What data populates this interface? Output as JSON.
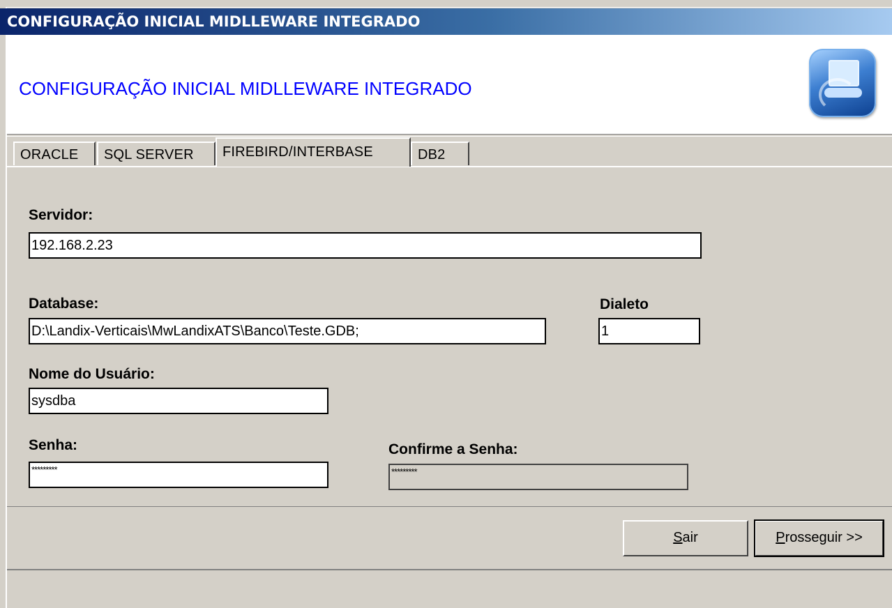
{
  "window": {
    "title": "CONFIGURAÇÃO INICIAL MIDLLEWARE INTEGRADO",
    "header_title": "CONFIGURAÇÃO INICIAL MIDLLEWARE INTEGRADO",
    "logo_icon": "computer-network-icon"
  },
  "tabs": [
    {
      "label": "ORACLE",
      "active": false
    },
    {
      "label": "SQL SERVER",
      "active": false
    },
    {
      "label": "FIREBIRD/INTERBASE",
      "active": true
    },
    {
      "label": "DB2",
      "active": false
    }
  ],
  "form": {
    "servidor_label": "Servidor:",
    "servidor_value": "192.168.2.23",
    "database_label": "Database:",
    "database_value": "D:\\Landix-Verticais\\MwLandixATS\\Banco\\Teste.GDB;",
    "dialeto_label": "Dialeto",
    "dialeto_value": "1",
    "usuario_label": "Nome do Usuário:",
    "usuario_value": "sysdba",
    "senha_label": "Senha:",
    "senha_value": "*********",
    "confirme_label": "Confirme a Senha:",
    "confirme_value": "*********"
  },
  "buttons": {
    "sair_hotkey": "S",
    "sair_rest": "air",
    "prosseguir_hotkey": "P",
    "prosseguir_rest": "rosseguir >>"
  },
  "colors": {
    "title_gradient_start": "#0a246a",
    "title_gradient_end": "#a6caf0",
    "header_title": "#0000ff",
    "face": "#d4d0c8"
  }
}
